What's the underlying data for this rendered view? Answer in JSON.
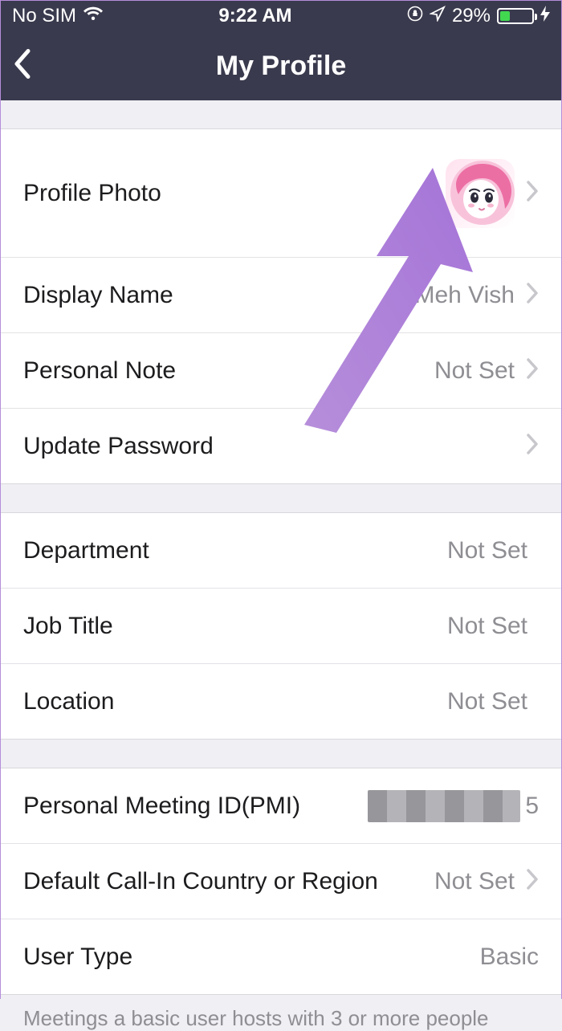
{
  "status": {
    "carrier": "No SIM",
    "time": "9:22 AM",
    "battery_pct": "29%"
  },
  "nav": {
    "title": "My Profile"
  },
  "section1": {
    "profile_photo": {
      "label": "Profile Photo"
    },
    "display_name": {
      "label": "Display Name",
      "value": "Meh Vish"
    },
    "personal_note": {
      "label": "Personal Note",
      "value": "Not Set"
    },
    "update_password": {
      "label": "Update Password"
    }
  },
  "section2": {
    "department": {
      "label": "Department",
      "value": "Not Set"
    },
    "job_title": {
      "label": "Job Title",
      "value": "Not Set"
    },
    "location": {
      "label": "Location",
      "value": "Not Set"
    }
  },
  "section3": {
    "pmi": {
      "label": "Personal Meeting ID(PMI)",
      "tail": "5"
    },
    "call_in": {
      "label": "Default Call-In Country or Region",
      "value": "Not Set"
    },
    "user_type": {
      "label": "User Type",
      "value": "Basic"
    }
  },
  "footer": {
    "note": "Meetings a basic user hosts with 3 or more people"
  }
}
